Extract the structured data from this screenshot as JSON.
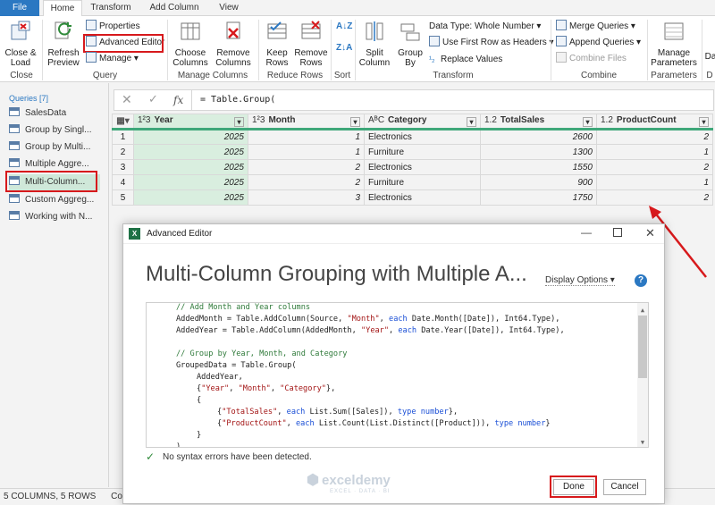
{
  "tabs": [
    {
      "label": "File"
    },
    {
      "label": "Home"
    },
    {
      "label": "Transform"
    },
    {
      "label": "Add Column"
    },
    {
      "label": "View"
    }
  ],
  "ribbon": {
    "close_load": "Close &\nLoad",
    "refresh_preview": "Refresh\nPreview",
    "properties": "Properties",
    "advanced_editor": "Advanced Editor",
    "manage": "Manage",
    "choose_columns": "Choose\nColumns",
    "remove_columns": "Remove\nColumns",
    "keep_rows": "Keep\nRows",
    "remove_rows": "Remove\nRows",
    "split_column": "Split\nColumn",
    "group_by": "Group\nBy",
    "data_type": "Data Type: Whole Number",
    "first_row_headers": "Use First Row as Headers",
    "replace_values": "Replace Values",
    "merge_queries": "Merge Queries",
    "append_queries": "Append Queries",
    "combine_files": "Combine Files",
    "manage_parameters": "Manage\nParameters",
    "data_cut": "Da",
    "groups": {
      "close": "Close",
      "query": "Query",
      "manage_columns": "Manage Columns",
      "reduce_rows": "Reduce Rows",
      "sort": "Sort",
      "transform": "Transform",
      "combine": "Combine",
      "parameters": "Parameters",
      "data_cut": "D"
    }
  },
  "queries": {
    "header": "Queries [7]",
    "items": [
      "SalesData",
      "Group by Singl...",
      "Group by Multi...",
      "Multiple Aggre...",
      "Multi-Column...",
      "Custom Aggreg...",
      "Working with N..."
    ]
  },
  "formula": {
    "text": "= Table.Group(",
    "fx": "fx"
  },
  "table": {
    "columns": [
      {
        "type": "1²3",
        "name": "Year"
      },
      {
        "type": "1²3",
        "name": "Month"
      },
      {
        "type": "AᴮC",
        "name": "Category"
      },
      {
        "type": "1.2",
        "name": "TotalSales"
      },
      {
        "type": "1.2",
        "name": "ProductCount"
      }
    ],
    "rows": [
      {
        "n": "1",
        "year": "2025",
        "month": "1",
        "category": "Electronics",
        "sales": "2600",
        "count": "2"
      },
      {
        "n": "2",
        "year": "2025",
        "month": "1",
        "category": "Furniture",
        "sales": "1300",
        "count": "1"
      },
      {
        "n": "3",
        "year": "2025",
        "month": "2",
        "category": "Electronics",
        "sales": "1550",
        "count": "2"
      },
      {
        "n": "4",
        "year": "2025",
        "month": "2",
        "category": "Furniture",
        "sales": "900",
        "count": "1"
      },
      {
        "n": "5",
        "year": "2025",
        "month": "3",
        "category": "Electronics",
        "sales": "1750",
        "count": "2"
      }
    ]
  },
  "status": {
    "left": "5 COLUMNS, 5 ROWS",
    "middle": "Column p"
  },
  "dialog": {
    "title": "Advanced Editor",
    "heading": "Multi-Column Grouping with Multiple A...",
    "display_options": "Display Options",
    "help": "?",
    "syntax_msg": "No syntax errors have been detected.",
    "done": "Done",
    "cancel": "Cancel",
    "watermark": "exceldemy",
    "watermark_sub": "EXCEL · DATA · BI"
  },
  "colors": {
    "accent": "#2b78c2",
    "highlight": "#d7191c",
    "selected_cell": "#d9eedf",
    "green_bar": "#3fa77a"
  }
}
